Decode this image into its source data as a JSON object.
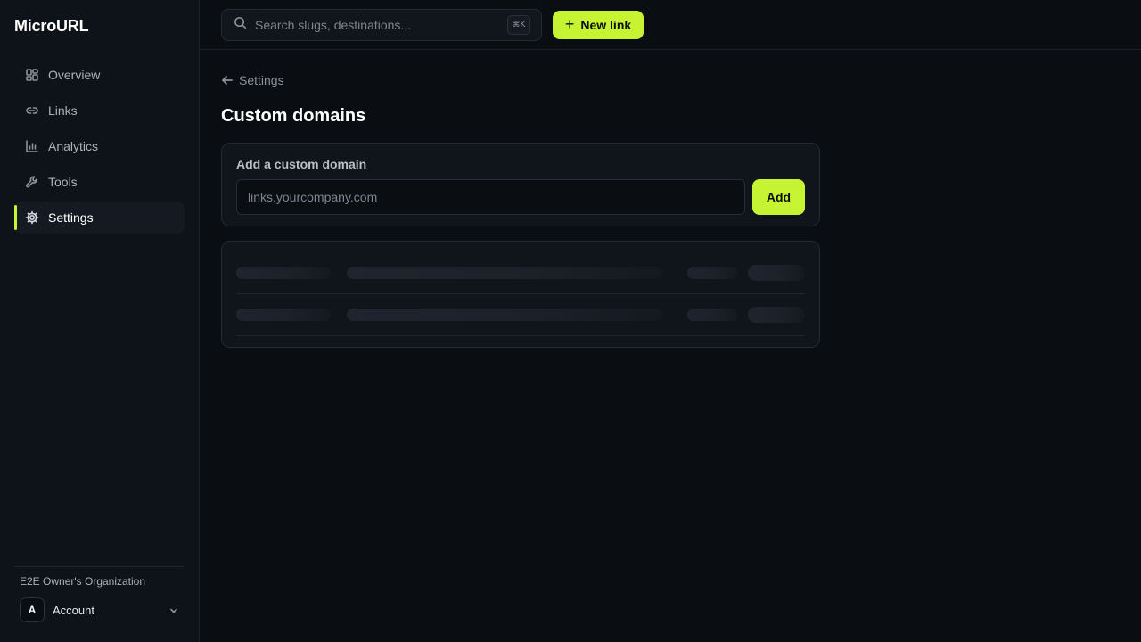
{
  "app": {
    "name": "MicroURL"
  },
  "sidebar": {
    "items": [
      {
        "label": "Overview",
        "icon": "grid-icon",
        "active": false
      },
      {
        "label": "Links",
        "icon": "link-icon",
        "active": false
      },
      {
        "label": "Analytics",
        "icon": "bar-chart-icon",
        "active": false
      },
      {
        "label": "Tools",
        "icon": "wrench-icon",
        "active": false
      },
      {
        "label": "Settings",
        "icon": "gear-icon",
        "active": true
      }
    ],
    "org_name": "E2E Owner's Organization",
    "account": {
      "avatar_letter": "A",
      "label": "Account"
    }
  },
  "topbar": {
    "search_placeholder": "Search slugs, destinations...",
    "shortcut": "⌘K",
    "new_link_label": "New link"
  },
  "main": {
    "back_label": "Settings",
    "title": "Custom domains",
    "add_card": {
      "label": "Add a custom domain",
      "input_placeholder": "links.yourcompany.com",
      "input_value": "",
      "button_label": "Add"
    },
    "domains_list": {
      "loading": true,
      "skeleton_rows": 2
    }
  },
  "colors": {
    "accent": "#c6f432",
    "background": "#0a0d12",
    "sidebar": "#0e1219",
    "card": "#10151c"
  }
}
